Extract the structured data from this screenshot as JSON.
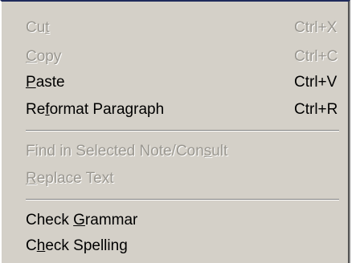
{
  "menu": {
    "items": [
      {
        "label": "Cut",
        "mnemonic_index": 2,
        "shortcut": "Ctrl+X",
        "enabled": false
      },
      {
        "label": "Copy",
        "mnemonic_index": 0,
        "shortcut": "Ctrl+C",
        "enabled": false
      },
      {
        "label": "Paste",
        "mnemonic_index": 0,
        "shortcut": "Ctrl+V",
        "enabled": true
      },
      {
        "label": "Reformat Paragraph",
        "mnemonic_index": 2,
        "shortcut": "Ctrl+R",
        "enabled": true
      },
      {
        "label": "Find in Selected Note/Consult",
        "mnemonic_index": 25,
        "shortcut": "",
        "enabled": false
      },
      {
        "label": "Replace Text",
        "mnemonic_index": 0,
        "shortcut": "",
        "enabled": false
      },
      {
        "label": "Check Grammar",
        "mnemonic_index": 6,
        "shortcut": "",
        "enabled": true
      },
      {
        "label": "Check Spelling",
        "mnemonic_index": 1,
        "shortcut": "",
        "enabled": true
      }
    ],
    "colors": {
      "background": "#d4d0c8",
      "enabled_text": "#000000",
      "disabled_text": "#9a9790",
      "top_border": "#1f2b5c"
    }
  }
}
